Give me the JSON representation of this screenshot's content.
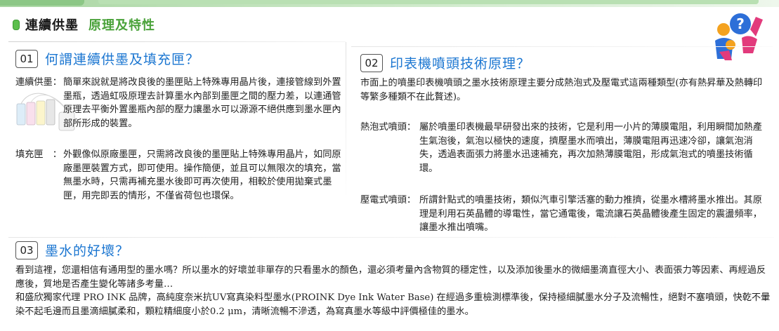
{
  "header": {
    "title": "連續供墨",
    "subtitle": "原理及特性"
  },
  "sections": {
    "s1": {
      "number": "01",
      "title": "何謂連續供墨及填充匣？",
      "items": [
        {
          "label": "連續供墨：",
          "text": "簡單來說就是將改良後的墨匣貼上特殊專用晶片後，連接管線到外置墨瓶，透過虹吸原理去計算墨水內部到墨匣之間的壓力差，以連通管原理去平衡外置墨瓶內部的壓力讓墨水可以源源不絕供應到墨水匣內部所形成的裝置。"
        },
        {
          "label": "填充匣　：",
          "text": "外觀像似原廠墨匣，只需將改良後的墨匣貼上特殊專用晶片，如同原廠墨匣裝置方式，即可使用。操作簡便，並且可以無限次的填充，當無墨水時，只需再補充墨水後即可再次使用，相較於使用拋棄式墨匣，用完即丟的情形，不僅省荷包也環保。"
        }
      ]
    },
    "s2": {
      "number": "02",
      "title": "印表機噴頭技術原理？",
      "intro": "市面上的噴墨印表機噴頭之墨水技術原理主要分成熱泡式及壓電式這兩種類型(亦有熱昇華及熱轉印等繁多種類不在此贅述)。",
      "items": [
        {
          "label": "熱泡式噴頭：",
          "text": "屬於噴墨印表機最早研發出來的技術，它是利用一小片的薄膜電阻，利用瞬間加熱產生氣泡後，氣泡以極快的速度，擠壓墨水而噴出，薄膜電阻再迅速冷卻，讓氣泡消失，透過表面張力將墨水迅速補充，再次加熱薄膜電阻，形成氣泡式的噴墨技術循環。"
        },
        {
          "label": "壓電式噴頭：",
          "text": "所謂針點式的噴墨技術，類似汽車引擎活塞的動力推擠，從墨水槽將墨水推出。其原理是利用石英晶體的導電性，當它通電後，電流讓石英晶體後產生固定的震盪頻率，讓墨水推出噴嘴。"
        }
      ]
    },
    "s3": {
      "number": "03",
      "title": "墨水的好壞？",
      "p1": "看到這裡，您還相信有通用型的墨水嗎？所以墨水的好壞並非單存的只看墨水的顏色，還必須考量內含物質的穩定性，以及添加後墨水的微細墨滴直徑大小、表面張力等因素、再經過反應後，質地是否產生變化等諸多考量…",
      "p2": "和盛欣獨家代理 PRO INK 品牌，高純度奈米抗UV寫真染料型墨水(PROINK Dye Ink Water Base) 在經過多重檢測標準後，保持極細膩墨水分子及流暢性，絕對不塞噴頭，快乾不暈染不起毛邊而且墨滴細膩柔和，顆粒精細度小於0.2 μm，清晰流暢不滲透，為寫真墨水等級中評價極佳的墨水。"
    }
  },
  "colors": {
    "accent_blue": "#1b76d1",
    "accent_green": "#4aa23a",
    "topbar_green": "#a9d6a2"
  },
  "icons": {
    "mascot": "question-mascot-icon",
    "ink_system": "ink-supply-image",
    "header_dot": "green-bullet-icon"
  }
}
